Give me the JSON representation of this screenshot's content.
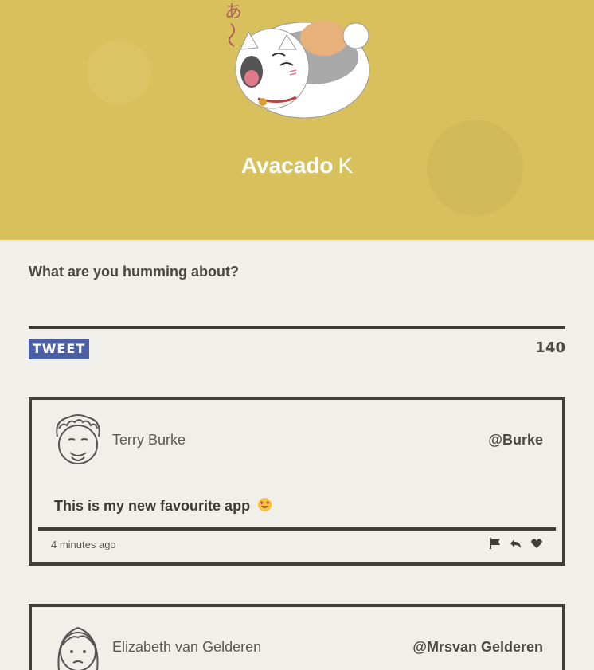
{
  "profile": {
    "first_name": "Avacado",
    "last_initial": "K"
  },
  "compose": {
    "prompt": "What are you humming about?",
    "tweet_label": "TWEET",
    "char_count": "140"
  },
  "tweets": [
    {
      "name": "Terry Burke",
      "handle": "@Burke",
      "message": "This is my new favourite app",
      "time": "4 minutes ago",
      "avatar_icon": "man-face-icon",
      "emoji_icon": "heart-eyes-emoji-icon"
    },
    {
      "name": "Elizabeth van Gelderen",
      "handle": "@Mrsvan Gelderen",
      "avatar_icon": "woman-face-icon"
    }
  ],
  "action_icons": [
    "flag-icon",
    "reply-icon",
    "heart-icon"
  ],
  "colors": {
    "header_bg": "#d8c15c",
    "page_bg": "#f0efe9",
    "tweet_button": "#4b5fa6",
    "border": "#3f3e38"
  }
}
